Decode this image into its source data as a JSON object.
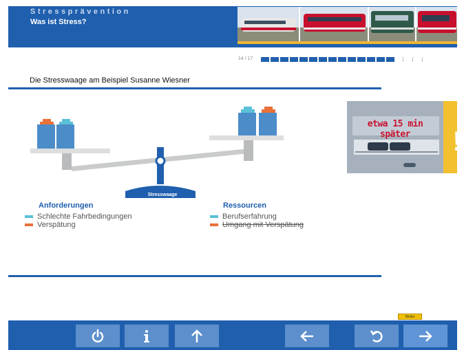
{
  "header": {
    "kicker": "Stressprävention",
    "title": "Was ist Stress?"
  },
  "progress": {
    "label": "14 / 17",
    "current": 14,
    "total": 17
  },
  "section": {
    "title": "Die Stresswaage am Beispiel Susanne Wiesner"
  },
  "balance": {
    "base_label": "Stresswaage"
  },
  "legend": {
    "left": {
      "title": "Anforderungen",
      "items": [
        {
          "label": "Schlechte Fahrbedingungen",
          "color": "#5bc0d8",
          "struck": false
        },
        {
          "label": "Verspätung",
          "color": "#e9713a",
          "struck": false
        }
      ]
    },
    "right": {
      "title": "Ressourcen",
      "items": [
        {
          "label": "Berufserfahrung",
          "color": "#5bc0d8",
          "struck": false
        },
        {
          "label": "Umgang mit Verspätung",
          "color": "#e9713a",
          "struck": true
        }
      ]
    }
  },
  "side_photo": {
    "sign_text": "etwa 15 min später"
  },
  "footer": {
    "tooltip": "Weiter",
    "buttons": [
      {
        "name": "power-button",
        "icon": "power-icon"
      },
      {
        "name": "info-button",
        "icon": "info-icon"
      },
      {
        "name": "up-button",
        "icon": "arrow-up-icon"
      },
      {
        "name": "back-button",
        "icon": "arrow-left-icon"
      },
      {
        "name": "replay-button",
        "icon": "replay-icon"
      },
      {
        "name": "next-button",
        "icon": "arrow-right-icon"
      }
    ]
  },
  "colors": {
    "brand_blue": "#1f5fae",
    "button_blue": "#5c8fcc",
    "accent_yellow": "#f0b531",
    "cyan": "#5bc0d8",
    "orange": "#e9713a"
  }
}
